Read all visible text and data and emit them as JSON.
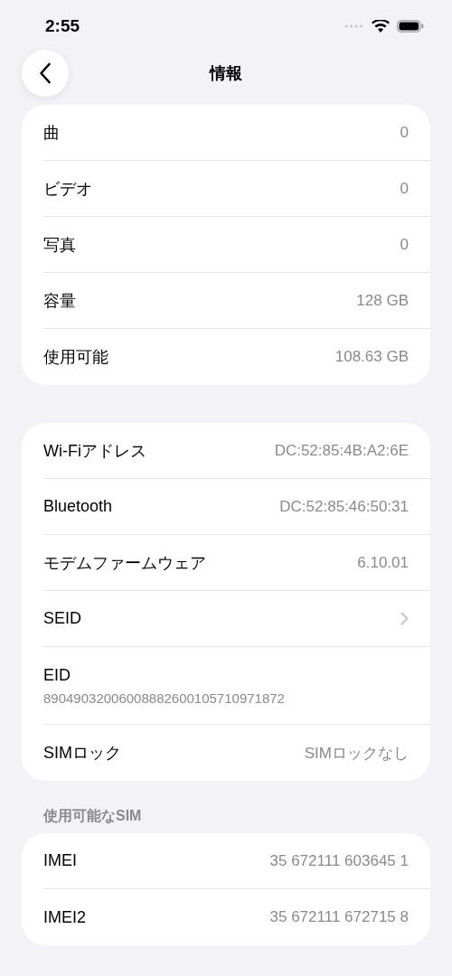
{
  "status_bar": {
    "time": "2:55"
  },
  "nav": {
    "title": "情報"
  },
  "sections": [
    {
      "rows": [
        {
          "kind": "value",
          "label": "曲",
          "value": "0"
        },
        {
          "kind": "value",
          "label": "ビデオ",
          "value": "0"
        },
        {
          "kind": "value",
          "label": "写真",
          "value": "0"
        },
        {
          "kind": "value",
          "label": "容量",
          "value": "128 GB"
        },
        {
          "kind": "value",
          "label": "使用可能",
          "value": "108.63 GB"
        }
      ]
    },
    {
      "rows": [
        {
          "kind": "value",
          "label": "Wi-Fiアドレス",
          "value": "DC:52:85:4B:A2:6E"
        },
        {
          "kind": "value",
          "label": "Bluetooth",
          "value": "DC:52:85:46:50:31"
        },
        {
          "kind": "value",
          "label": "モデムファームウェア",
          "value": "6.10.01"
        },
        {
          "kind": "chevron",
          "label": "SEID"
        },
        {
          "kind": "stacked",
          "label": "EID",
          "value": "89049032006008882600105710971872"
        },
        {
          "kind": "value",
          "label": "SIMロック",
          "value": "SIMロックなし"
        }
      ]
    },
    {
      "header": "使用可能なSIM",
      "rows": [
        {
          "kind": "value",
          "label": "IMEI",
          "value": "35 672111 603645 1"
        },
        {
          "kind": "value",
          "label": "IMEI2",
          "value": "35 672111 672715 8"
        }
      ]
    }
  ]
}
